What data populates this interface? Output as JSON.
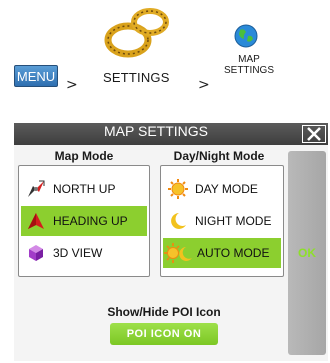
{
  "breadcrumb": {
    "menu_label": "MENU",
    "separator": ">",
    "settings_label": "SETTINGS",
    "map_settings_label_line1": "MAP",
    "map_settings_label_line2": "SETTINGS"
  },
  "dialog": {
    "title": "MAP SETTINGS",
    "map_mode": {
      "label": "Map Mode",
      "selected": "HEADING UP",
      "options": [
        {
          "label": "NORTH UP",
          "icon": "compass-icon",
          "selected": false
        },
        {
          "label": "HEADING UP",
          "icon": "heading-arrow-icon",
          "selected": true
        },
        {
          "label": "3D VIEW",
          "icon": "cube-icon",
          "selected": false
        }
      ]
    },
    "day_night_mode": {
      "label": "Day/Night Mode",
      "selected": "AUTO MODE",
      "options": [
        {
          "label": "DAY MODE",
          "icon": "sun-icon",
          "selected": false
        },
        {
          "label": "NIGHT MODE",
          "icon": "moon-icon",
          "selected": false
        },
        {
          "label": "AUTO MODE",
          "icon": "sun-moon-icon",
          "selected": true
        }
      ]
    },
    "ok_label": "OK",
    "poi": {
      "label": "Show/Hide POI Icon",
      "button_label": "POI ICON ON"
    }
  },
  "colors": {
    "selected_bg": "#8ccf2f",
    "title_bar": "#4a4a4a",
    "ok_text": "#8ee02a",
    "poi_button": "#86cc2c",
    "menu_button": "#3d7fc0"
  }
}
